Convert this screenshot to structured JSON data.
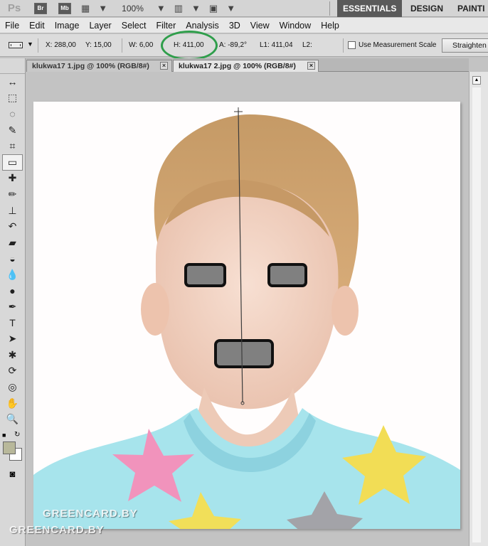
{
  "app": {
    "logo": "Ps",
    "bridge_button": "Br",
    "minibridge_button": "Mb",
    "zoom": "100%",
    "workspaces": [
      "ESSENTIALS",
      "DESIGN",
      "PAINTI"
    ]
  },
  "menu": [
    "File",
    "Edit",
    "Image",
    "Layer",
    "Select",
    "Filter",
    "Analysis",
    "3D",
    "View",
    "Window",
    "Help"
  ],
  "options": {
    "x": "X: 288,00",
    "y": "Y: 15,00",
    "w": "W: 6,00",
    "h": "H: 411,00",
    "angle": "A: -89,2°",
    "l1": "L1: 411,04",
    "l2": "L2:",
    "use_measurement_scale": "Use Measurement Scale",
    "straighten": "Straighten"
  },
  "tabs": [
    {
      "label": "klukwa17 1.jpg @ 100% (RGB/8#)"
    },
    {
      "label": "klukwa17 2.jpg @ 100% (RGB/8#)"
    }
  ],
  "watermark": [
    "GREENCARD.BY",
    "GREENCARD.BY"
  ],
  "colors": {
    "highlight": "#2f9e4b",
    "workspace_active_bg": "#5a5a5a",
    "foreground_swatch": "#b8b89a",
    "censor_fill": "#808080"
  },
  "icons": {
    "tools": [
      "move-icon",
      "marquee-icon",
      "lasso-icon",
      "quick-select-icon",
      "crop-icon",
      "ruler-icon",
      "healing-brush-icon",
      "brush-icon",
      "stamp-icon",
      "history-brush-icon",
      "eraser-icon",
      "paint-bucket-icon",
      "blur-icon",
      "dodge-icon",
      "pen-icon",
      "type-icon",
      "path-select-icon",
      "shape-icon",
      "rotate-3d-icon",
      "orbit-3d-icon",
      "hand-icon",
      "zoom-icon"
    ],
    "tab_close": "close-icon"
  }
}
